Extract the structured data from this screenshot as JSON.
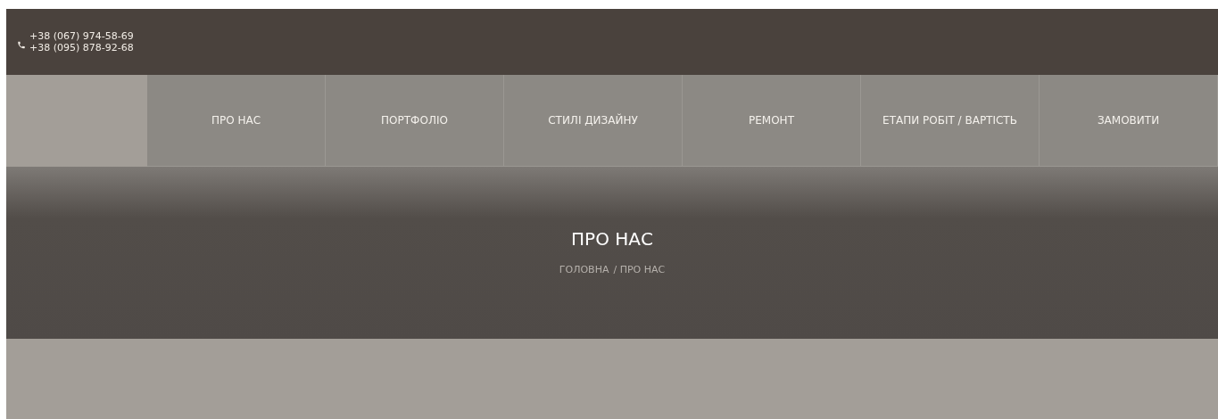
{
  "contacts": {
    "phones": [
      "+38 (067) 974-58-69",
      "+38 (095) 878-92-68"
    ]
  },
  "nav": {
    "items": [
      {
        "label": "ПРО НАС"
      },
      {
        "label": "ПОРТФОЛІО"
      },
      {
        "label": "СТИЛІ ДИЗАЙНУ"
      },
      {
        "label": "РЕМОНТ"
      },
      {
        "label": "ЕТАПИ РОБІТ / ВАРТІСТЬ"
      },
      {
        "label": "ЗАМОВИТИ"
      }
    ]
  },
  "hero": {
    "title": "ПРО НАС",
    "breadcrumbs": [
      {
        "label": "ГОЛОВНА"
      },
      {
        "label": "/ ПРО НАС"
      }
    ]
  }
}
